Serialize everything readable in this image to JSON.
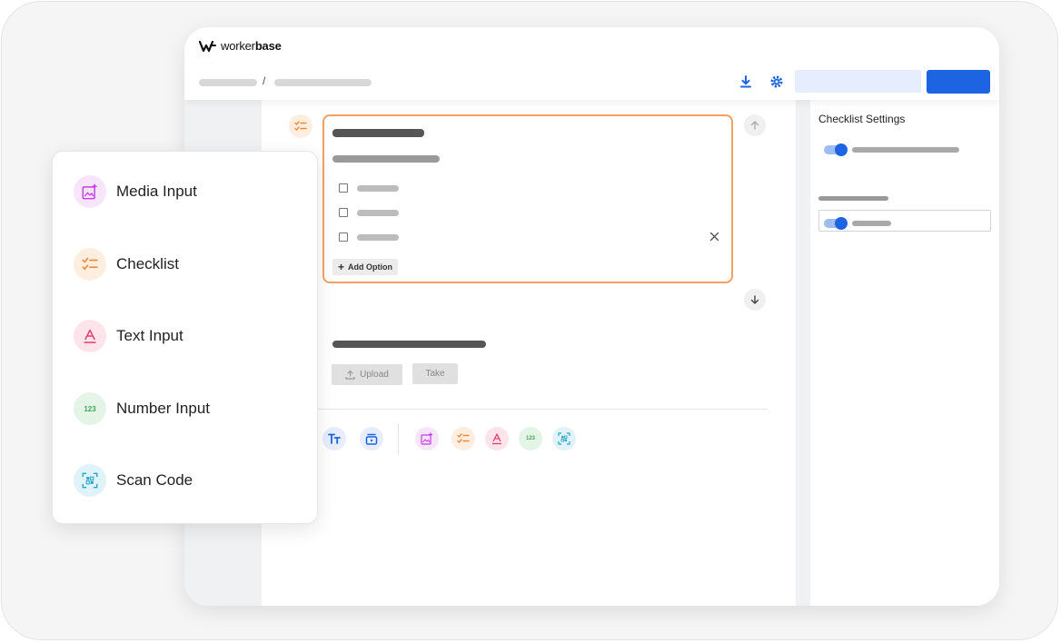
{
  "app": {
    "logo_prefix": "worker",
    "logo_suffix": "base"
  },
  "toolbar": {
    "breadcrumb_separator": "/"
  },
  "settings": {
    "title": "Checklist Settings"
  },
  "card": {
    "add_option_label": "Add Option"
  },
  "media_section": {
    "upload_label": "Upload",
    "take_label": "Take"
  },
  "popup": {
    "items": [
      {
        "label": "Media Input",
        "icon": "media-input-icon",
        "bg": "#f7e5fb",
        "color": "#c23ee0"
      },
      {
        "label": "Checklist",
        "icon": "checklist-icon",
        "bg": "#fdeedf",
        "color": "#ef8a3c"
      },
      {
        "label": "Text Input",
        "icon": "text-input-icon",
        "bg": "#fde3ea",
        "color": "#e0436f"
      },
      {
        "label": "Number Input",
        "icon": "number-input-icon",
        "bg": "#e4f4e6",
        "color": "#43a55a"
      },
      {
        "label": "Scan Code",
        "icon": "scan-code-icon",
        "bg": "#e0f3f8",
        "color": "#25a6c9"
      }
    ]
  },
  "number_icon_text": "123",
  "colors": {
    "primary": "#1d64e2",
    "card_border": "#f5a060",
    "primary_light": "#e6edfc"
  }
}
